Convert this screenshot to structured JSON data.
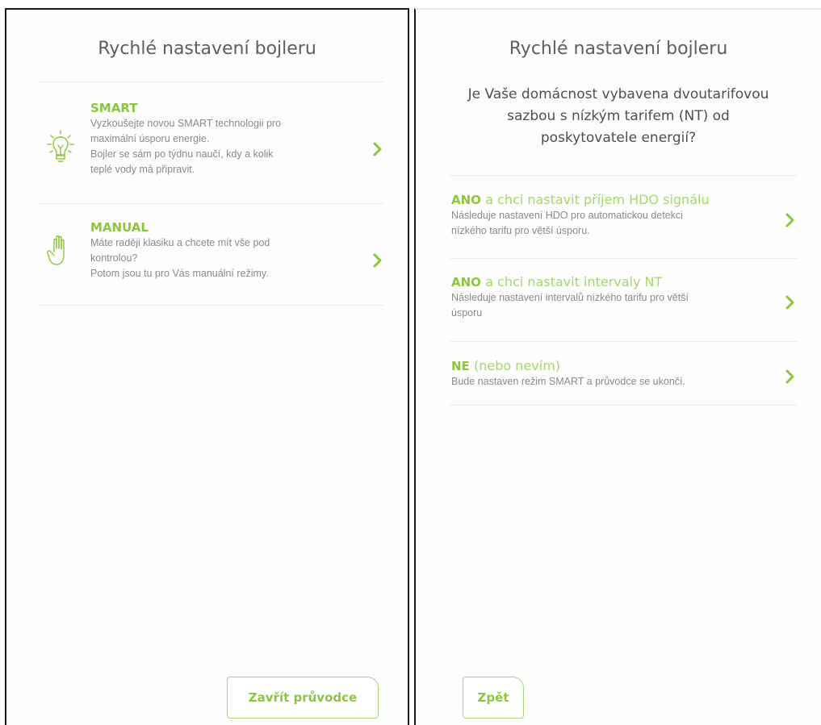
{
  "left": {
    "title": "Rychlé nastavení bojleru",
    "options": [
      {
        "heading": "SMART",
        "lines": [
          "Vyzkoušejte novou SMART technologii pro",
          "maximální úsporu energie.",
          "Bojler se sám po týdnu naučí, kdy a kolik",
          "teplé vody má připravit."
        ],
        "icon": "lightbulb-icon"
      },
      {
        "heading": "MANUAL",
        "lines": [
          "Máte raději klasiku a chcete mít vše pod",
          "kontrolou?",
          "Potom jsou tu pro Vás manuální režimy."
        ],
        "icon": "hand-icon"
      }
    ],
    "close_button": "Zavřít průvodce"
  },
  "right": {
    "title": "Rychlé nastavení bojleru",
    "question_lines": [
      "Je Vaše domácnost vybavena dvoutarifovou",
      "sazbou s nízkým tarifem (NT) od",
      "poskytovatele energií?"
    ],
    "options": [
      {
        "bold": "ANO",
        "rest": "a chci nastavit příjem HDO signálu",
        "lines": [
          "Následuje nastavení HDO pro automatickou detekci",
          "nízkého tarifu pro větší úsporu."
        ]
      },
      {
        "bold": "ANO",
        "rest": "a chci nastavit intervaly NT",
        "lines": [
          "Následuje nastavení intervalů nízkého tarifu pro větší",
          "úsporu"
        ]
      },
      {
        "bold": "NE",
        "rest": "(nebo nevím)",
        "lines": [
          "Bude nastaven režim SMART a průvodce se ukončí."
        ]
      }
    ],
    "back_button": "Zpět"
  },
  "colors": {
    "accent": "#8cc63f",
    "accent_light": "#a5d86a",
    "text": "#6b6b6b",
    "divider": "#ececec"
  }
}
